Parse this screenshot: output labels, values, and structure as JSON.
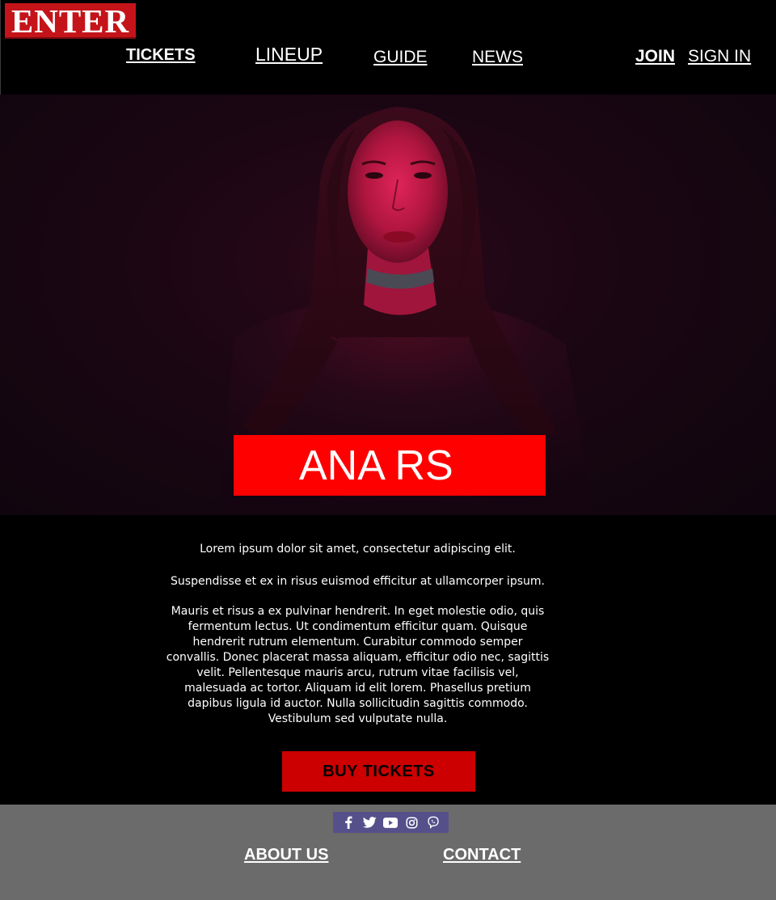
{
  "brand": {
    "logo_text": "ENTER"
  },
  "nav": {
    "tickets": "TICKETS",
    "lineup": "LINEUP",
    "guide": "GUIDE",
    "news": "NEWS",
    "join": "JOIN",
    "sign_in": "SIGN IN"
  },
  "hero": {
    "artist_name": "ANA RS"
  },
  "content": {
    "paragraphs": [
      "Lorem ipsum dolor sit amet, consectetur adipiscing elit.",
      "Suspendisse et ex in risus euismod efficitur at ullamcorper ipsum.",
      "Mauris et risus a ex pulvinar hendrerit. In eget molestie odio, quis fermentum lectus. Ut condimentum efficitur quam. Quisque hendrerit rutrum elementum. Curabitur commodo semper convallis. Donec placerat massa aliquam, efficitur odio nec, sagittis velit. Pellentesque mauris arcu, rutrum vitae facilisis vel, malesuada ac tortor. Aliquam id elit lorem. Phasellus pretium dapibus ligula id auctor. Nulla sollicitudin sagittis commodo. Vestibulum sed vulputate nulla."
    ],
    "buy_button": "BUY TICKETS"
  },
  "footer": {
    "social_icons": [
      "facebook-icon",
      "twitter-icon",
      "youtube-icon",
      "instagram-icon",
      "viber-icon"
    ],
    "about": "ABOUT US",
    "contact": "CONTACT"
  },
  "colors": {
    "brand_red": "#c4141a",
    "banner_red": "#ff0000",
    "button_red": "#cc0000",
    "footer_gray": "#6b6b6b",
    "social_bar": "#55508a"
  }
}
